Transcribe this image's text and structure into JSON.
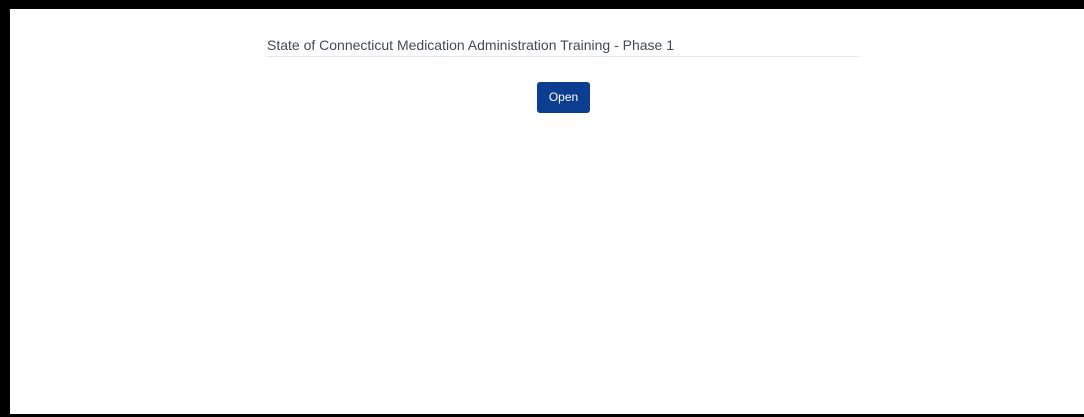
{
  "course": {
    "title": "State of Connecticut Medication Administration Training - Phase 1",
    "open_label": "Open"
  },
  "colors": {
    "frame": "#000000",
    "background": "#ffffff",
    "title_text": "#404a55",
    "divider": "#e6e8eb",
    "button_bg": "#0b3d91",
    "button_text": "#ffffff"
  }
}
